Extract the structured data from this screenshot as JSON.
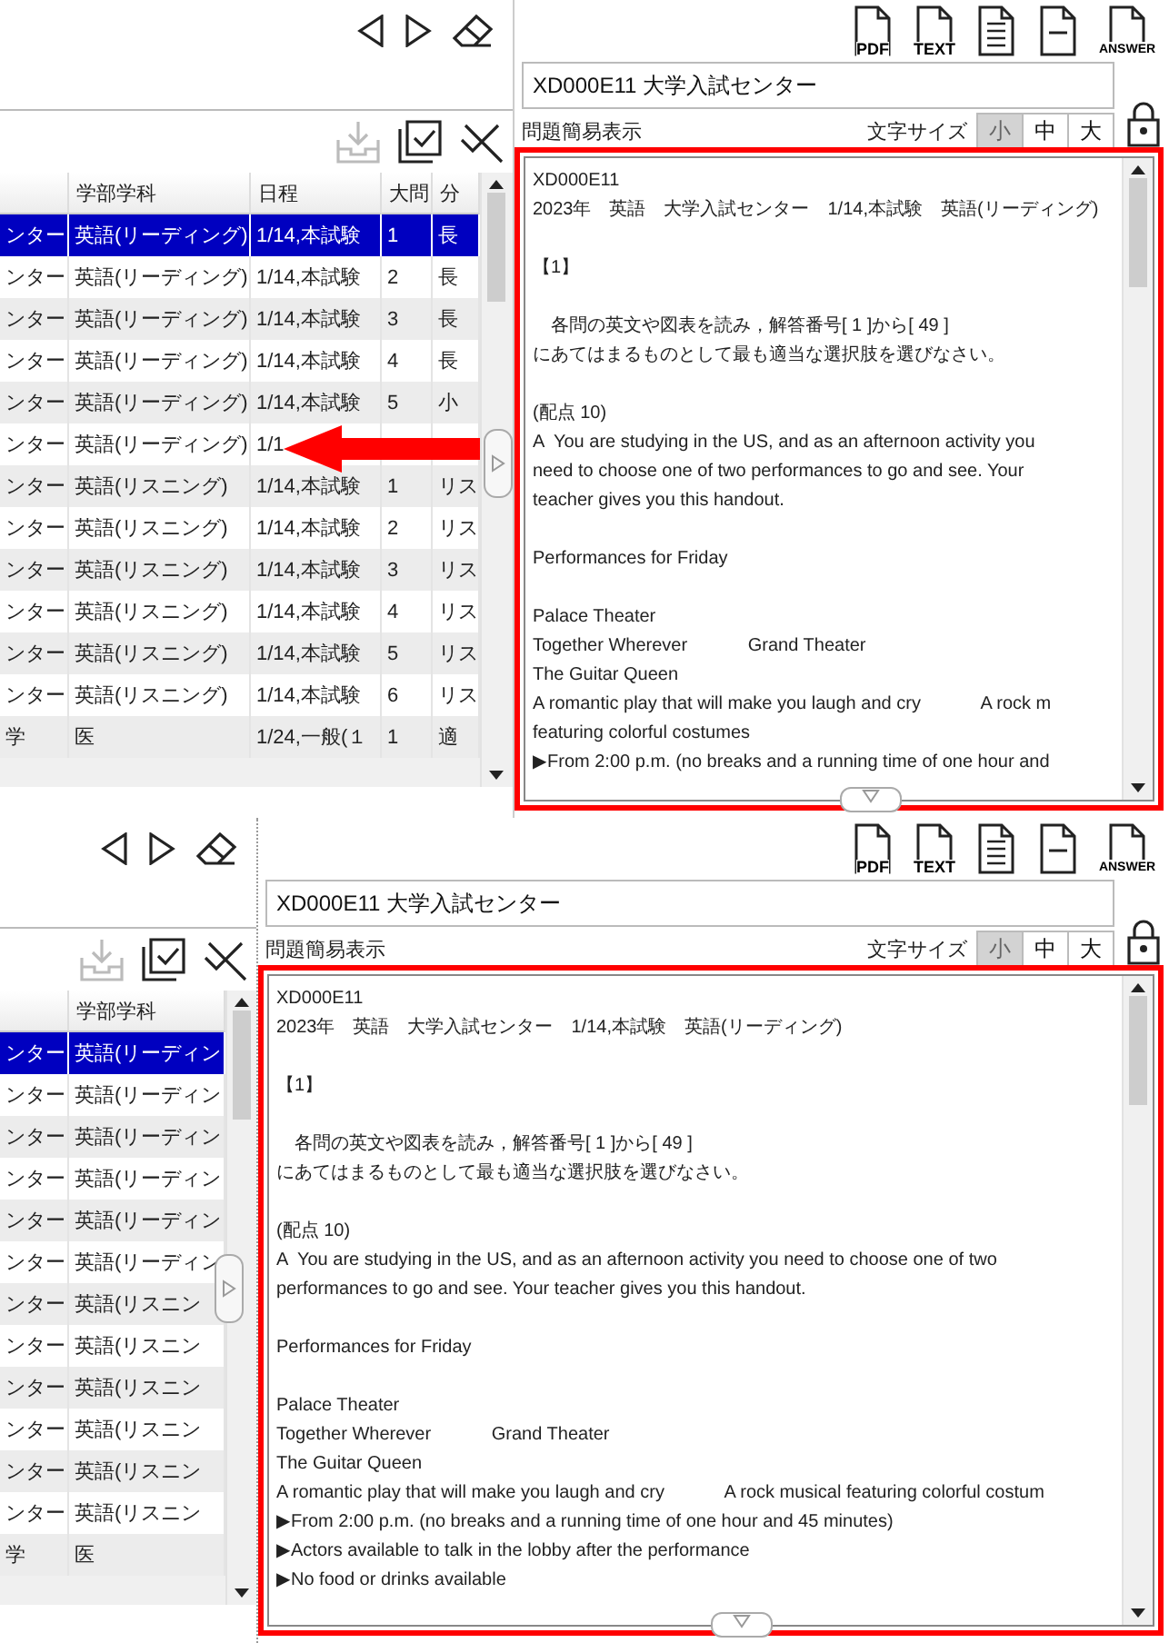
{
  "screens": [
    {
      "table_tools": [
        {
          "kind": "import",
          "disabled": true
        },
        {
          "kind": "check-all",
          "disabled": false
        },
        {
          "kind": "clear",
          "disabled": false
        }
      ],
      "table": {
        "columns": [
          "",
          "学部学科",
          "日程",
          "大問",
          "分"
        ],
        "rows": [
          {
            "selected": true,
            "cells": [
              "ンター",
              "英語(リーディング)",
              "1/14,本試験",
              "1",
              "長"
            ]
          },
          {
            "selected": false,
            "cells": [
              "ンター",
              "英語(リーディング)",
              "1/14,本試験",
              "2",
              "長"
            ]
          },
          {
            "selected": false,
            "cells": [
              "ンター",
              "英語(リーディング)",
              "1/14,本試験",
              "3",
              "長"
            ]
          },
          {
            "selected": false,
            "cells": [
              "ンター",
              "英語(リーディング)",
              "1/14,本試験",
              "4",
              "長"
            ]
          },
          {
            "selected": false,
            "cells": [
              "ンター",
              "英語(リーディング)",
              "1/14,本試験",
              "5",
              "小"
            ]
          },
          {
            "selected": false,
            "cells": [
              "ンター",
              "英語(リーディング)",
              "1/1"
            ]
          },
          {
            "selected": false,
            "cells": [
              "ンター",
              "英語(リスニング)",
              "1/14,本試験",
              "1",
              "リス"
            ]
          },
          {
            "selected": false,
            "cells": [
              "ンター",
              "英語(リスニング)",
              "1/14,本試験",
              "2",
              "リス"
            ]
          },
          {
            "selected": false,
            "cells": [
              "ンター",
              "英語(リスニング)",
              "1/14,本試験",
              "3",
              "リス"
            ]
          },
          {
            "selected": false,
            "cells": [
              "ンター",
              "英語(リスニング)",
              "1/14,本試験",
              "4",
              "リス"
            ]
          },
          {
            "selected": false,
            "cells": [
              "ンター",
              "英語(リスニング)",
              "1/14,本試験",
              "5",
              "リス"
            ]
          },
          {
            "selected": false,
            "cells": [
              "ンター",
              "英語(リスニング)",
              "1/14,本試験",
              "6",
              "リス"
            ]
          },
          {
            "selected": false,
            "cells": [
              "学",
              "医",
              "1/24,一般(１",
              "1",
              "適"
            ]
          }
        ]
      },
      "doc_buttons": [
        {
          "kind": "pdf",
          "label": "PDF"
        },
        {
          "kind": "text",
          "label": "TEXT"
        },
        {
          "kind": "lines"
        },
        {
          "kind": "single-line"
        },
        {
          "kind": "answer",
          "label": "ANSWER"
        }
      ],
      "title_field": {
        "value": "XD000E11 大学入試センター"
      },
      "simple_view_label": "問題簡易表示",
      "font_size": {
        "label": "文字サイズ",
        "options": [
          {
            "label": "小",
            "selected": true
          },
          {
            "label": "中",
            "selected": false
          },
          {
            "label": "大",
            "selected": false
          }
        ]
      },
      "paragraphs": [
        [
          "XD000E11",
          "2023年　英語　大学入試センター　1/14,本試験　英語(リーディング)"
        ],
        [
          "【1】"
        ],
        [
          "　各問の英文や図表を読み，解答番号[ 1 ]から[ 49 ]",
          "にあてはまるものとして最も適当な選択肢を選びなさい。"
        ],
        [
          "(配点 10)",
          "A  You are studying in the US, and as an afternoon activity you",
          "need to choose one of two performances to go and see. Your",
          "teacher gives you this handout."
        ],
        [
          "Performances for Friday"
        ],
        [
          "Palace Theater",
          "Together Wherever            Grand Theater",
          "The Guitar Queen",
          "A romantic play that will make you laugh and cry            A rock m",
          "featuring colorful costumes",
          "▶From 2:00 p.m. (no breaks and a running time of one hour and"
        ]
      ]
    },
    {
      "table_tools": [
        {
          "kind": "import",
          "disabled": true
        },
        {
          "kind": "check-all",
          "disabled": false
        },
        {
          "kind": "clear",
          "disabled": false
        }
      ],
      "table": {
        "columns": [
          "",
          "学部学科"
        ],
        "rows": [
          {
            "selected": true,
            "cells": [
              "ンター",
              "英語(リーディン"
            ]
          },
          {
            "selected": false,
            "cells": [
              "ンター",
              "英語(リーディン"
            ]
          },
          {
            "selected": false,
            "cells": [
              "ンター",
              "英語(リーディン"
            ]
          },
          {
            "selected": false,
            "cells": [
              "ンター",
              "英語(リーディン"
            ]
          },
          {
            "selected": false,
            "cells": [
              "ンター",
              "英語(リーディン"
            ]
          },
          {
            "selected": false,
            "cells": [
              "ンター",
              "英語(リーディン"
            ]
          },
          {
            "selected": false,
            "cells": [
              "ンター",
              "英語(リスニン"
            ]
          },
          {
            "selected": false,
            "cells": [
              "ンター",
              "英語(リスニン"
            ]
          },
          {
            "selected": false,
            "cells": [
              "ンター",
              "英語(リスニン"
            ]
          },
          {
            "selected": false,
            "cells": [
              "ンター",
              "英語(リスニン"
            ]
          },
          {
            "selected": false,
            "cells": [
              "ンター",
              "英語(リスニン"
            ]
          },
          {
            "selected": false,
            "cells": [
              "ンター",
              "英語(リスニン"
            ]
          },
          {
            "selected": false,
            "cells": [
              "学",
              "医"
            ]
          }
        ]
      },
      "doc_buttons": [
        {
          "kind": "pdf",
          "label": "PDF"
        },
        {
          "kind": "text",
          "label": "TEXT"
        },
        {
          "kind": "lines"
        },
        {
          "kind": "single-line"
        },
        {
          "kind": "answer",
          "label": "ANSWER"
        }
      ],
      "title_field": {
        "value": "XD000E11 大学入試センター"
      },
      "simple_view_label": "問題簡易表示",
      "font_size": {
        "label": "文字サイズ",
        "options": [
          {
            "label": "小",
            "selected": true
          },
          {
            "label": "中",
            "selected": false
          },
          {
            "label": "大",
            "selected": false
          }
        ]
      },
      "paragraphs": [
        [
          "XD000E11",
          "2023年　英語　大学入試センター　1/14,本試験　英語(リーディング)"
        ],
        [
          "【1】"
        ],
        [
          "　各問の英文や図表を読み，解答番号[ 1 ]から[ 49 ]",
          "にあてはまるものとして最も適当な選択肢を選びなさい。"
        ],
        [
          "(配点 10)",
          "A  You are studying in the US, and as an afternoon activity you need to choose one of two",
          "performances to go and see. Your teacher gives you this handout."
        ],
        [
          "Performances for Friday"
        ],
        [
          "Palace Theater",
          "Together Wherever            Grand Theater",
          "The Guitar Queen",
          "A romantic play that will make you laugh and cry            A rock musical featuring colorful costum",
          "▶From 2:00 p.m. (no breaks and a running time of one hour and 45 minutes)",
          "▶Actors available to talk in the lobby after the performance",
          "▶No food or drinks available"
        ]
      ]
    }
  ]
}
